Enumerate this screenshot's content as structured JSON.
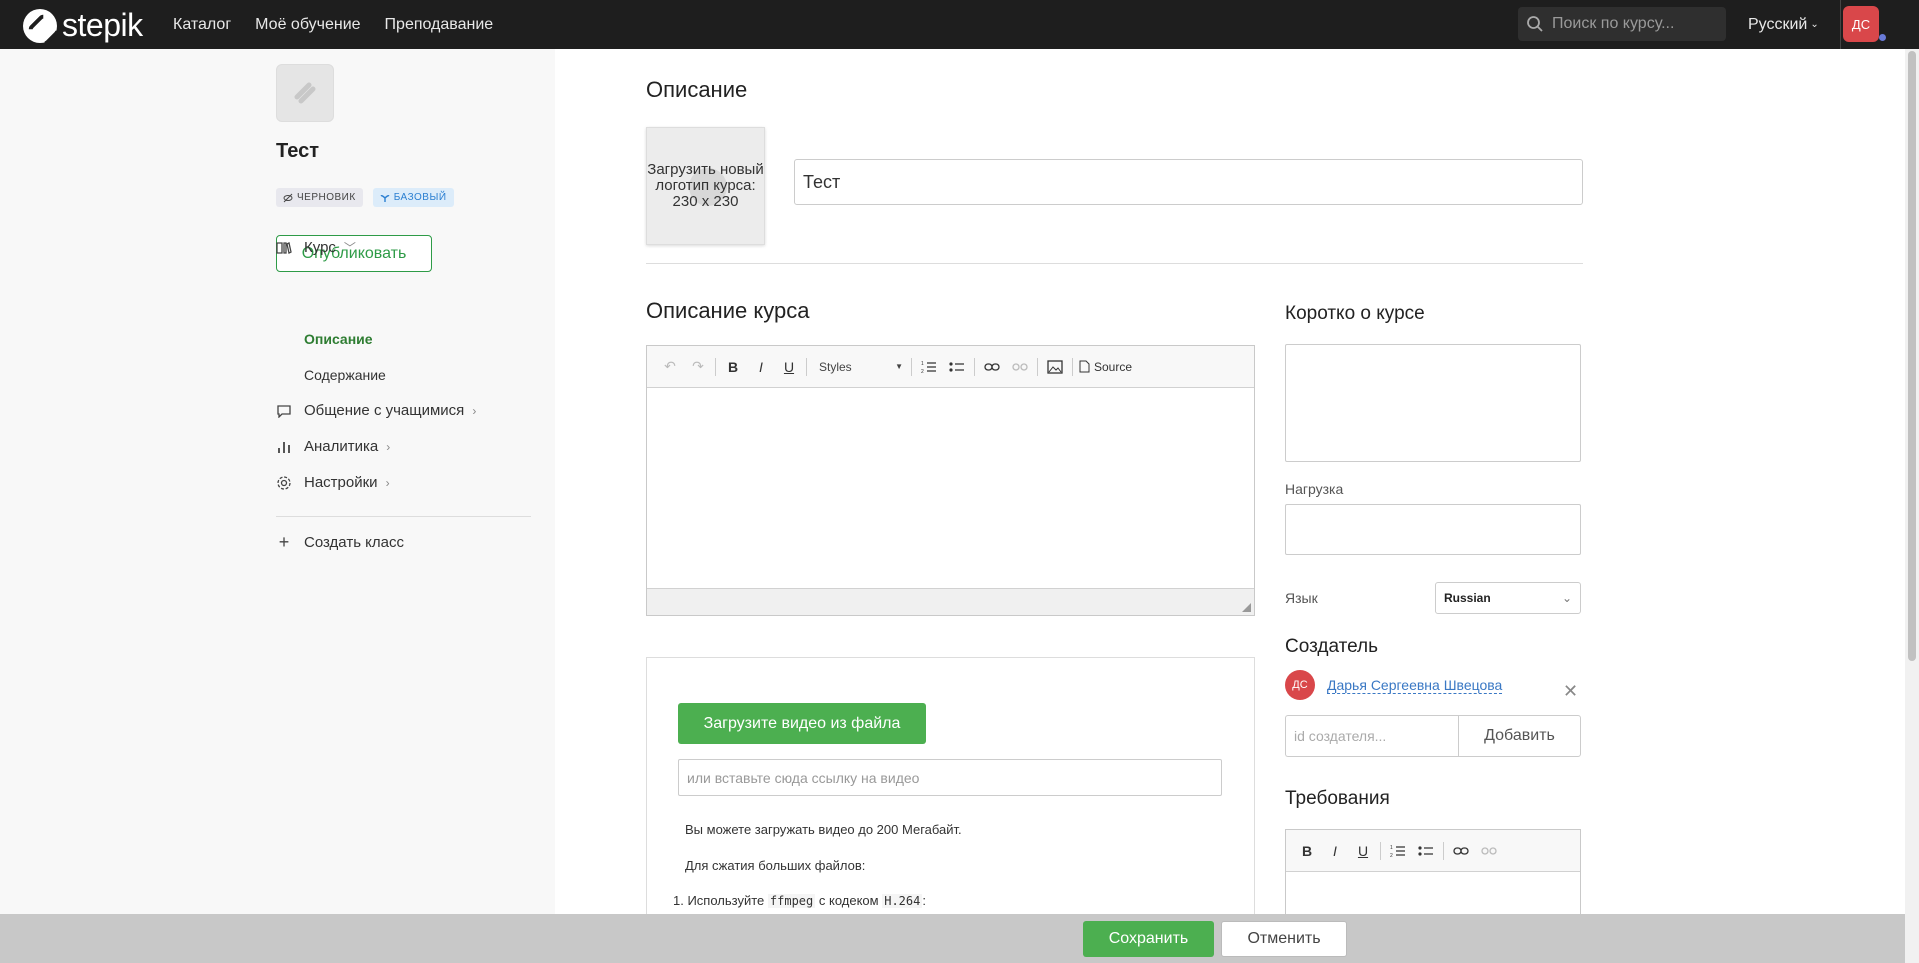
{
  "topnav": {
    "logo_text": "stepik",
    "links": [
      "Каталог",
      "Моё обучение",
      "Преподавание"
    ],
    "search_placeholder": "Поиск по курсу...",
    "language": "Русский",
    "avatar_initials": "ДС"
  },
  "sidebar": {
    "course_title": "Тест",
    "badges": {
      "draft": "ЧЕРНОВИК",
      "basic": "БАЗОВЫЙ"
    },
    "publish_label": "Опубликовать",
    "menu": {
      "course": "Курс",
      "description": "Описание",
      "content": "Содержание",
      "communication": "Общение с учащимися",
      "analytics": "Аналитика",
      "settings": "Настройки",
      "create_class": "Создать класс"
    }
  },
  "main": {
    "section_title": "Описание",
    "logo_upload_text": "Загрузить новый логотип курса: 230 x 230",
    "title_value": "Тест",
    "description_title": "Описание курса",
    "editor": {
      "styles_label": "Styles",
      "source_label": "Source"
    },
    "video": {
      "upload_label": "Загрузите видео из файла",
      "url_placeholder": "или вставьте сюда ссылку на видео",
      "note_limit": "Вы можете загружать видео до 200 Мегабайт.",
      "note_compress": "Для сжатия больших файлов:",
      "step1_prefix": "1. Используйте",
      "step1_tool": "ffmpeg",
      "step1_mid": "с кодеком",
      "step1_codec": "H.264",
      "step1_suffix": ":"
    }
  },
  "right": {
    "summary_title": "Коротко о курсе",
    "workload_label": "Нагрузка",
    "language_label": "Язык",
    "language_value": "Russian",
    "creator_title": "Создатель",
    "creator_initials": "ДС",
    "creator_name": "Дарья Сергеевна Швецова",
    "creator_id_placeholder": "id создателя...",
    "add_label": "Добавить",
    "requirements_title": "Требования"
  },
  "bottom": {
    "save_label": "Сохранить",
    "cancel_label": "Отменить"
  },
  "colors": {
    "accent_green": "#4caf50",
    "nav_bg": "#1e1e1e",
    "avatar_red": "#d9474a",
    "link_blue": "#3a78c4"
  }
}
